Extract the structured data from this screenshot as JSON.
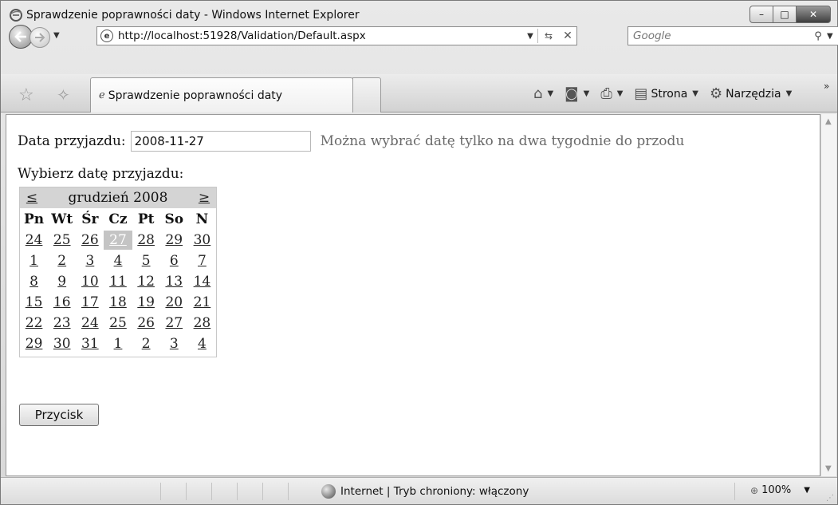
{
  "window": {
    "title": "Sprawdzenie poprawności daty - Windows Internet Explorer",
    "controls": {
      "minimize": "–",
      "maximize": "□",
      "close": "✕"
    }
  },
  "nav": {
    "url": "http://localhost:51928/Validation/Default.aspx",
    "search_placeholder": "Google"
  },
  "tab": {
    "label": "Sprawdzenie poprawności daty"
  },
  "toolbar": {
    "page_label": "Strona",
    "tools_label": "Narzędzia"
  },
  "form": {
    "date_label": "Data przyjazdu:",
    "date_value": "2008-11-27",
    "hint": "Można wybrać datę tylko na dwa tygodnie do przodu",
    "calendar_caption": "Wybierz datę przyjazdu:",
    "button_label": "Przycisk"
  },
  "calendar": {
    "prev": "≤",
    "next": "≥",
    "month_label": "grudzień 2008",
    "day_headers": [
      "Pn",
      "Wt",
      "Śr",
      "Cz",
      "Pt",
      "So",
      "N"
    ],
    "selected_day": "27",
    "weeks": [
      [
        "24",
        "25",
        "26",
        "27",
        "28",
        "29",
        "30"
      ],
      [
        "1",
        "2",
        "3",
        "4",
        "5",
        "6",
        "7"
      ],
      [
        "8",
        "9",
        "10",
        "11",
        "12",
        "13",
        "14"
      ],
      [
        "15",
        "16",
        "17",
        "18",
        "19",
        "20",
        "21"
      ],
      [
        "22",
        "23",
        "24",
        "25",
        "26",
        "27",
        "28"
      ],
      [
        "29",
        "30",
        "31",
        "1",
        "2",
        "3",
        "4"
      ]
    ]
  },
  "status": {
    "zone": "Internet | Tryb chroniony: włączony",
    "zoom": "100%"
  },
  "icons": {
    "back": "back-arrow-icon",
    "forward": "forward-arrow-icon",
    "home": "home-icon",
    "feeds": "rss-icon",
    "print": "printer-icon",
    "page": "page-icon",
    "tools": "gear-icon"
  }
}
